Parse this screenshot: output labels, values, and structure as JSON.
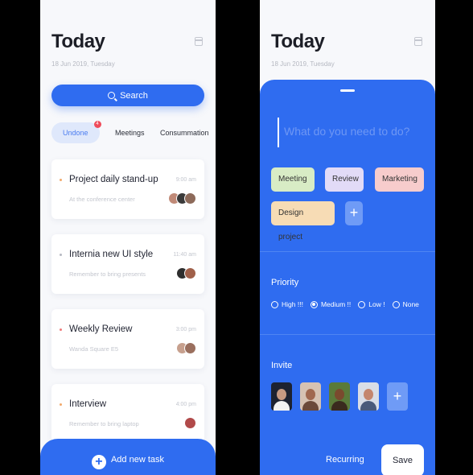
{
  "left_screen": {
    "title": "Today",
    "date": "18 Jun 2019, Tuesday",
    "search_label": "Search",
    "tabs": [
      {
        "label": "Undone",
        "badge": "4",
        "active": true
      },
      {
        "label": "Meetings",
        "active": false
      },
      {
        "label": "Consummation",
        "active": false
      }
    ],
    "tasks": [
      {
        "title": "Project daily stand-up",
        "time": "9:00 am",
        "subtitle": "At the conference center",
        "dot_color": "#f2a96b"
      },
      {
        "title": "Internia new UI style",
        "time": "11:40 am",
        "subtitle": "Remember to bring presents",
        "dot_color": "#b6b9c2"
      },
      {
        "title": "Weekly Review",
        "time": "3:00 pm",
        "subtitle": "Wanda Square E5",
        "dot_color": "#ef7b7b"
      },
      {
        "title": "Interview",
        "time": "4:00 pm",
        "subtitle": "Remember to bring laptop",
        "dot_color": "#f2a96b"
      }
    ],
    "add_task_label": "Add new task"
  },
  "right_screen": {
    "title": "Today",
    "date": "18 Jun 2019, Tuesday",
    "task_placeholder": "What do you need to do?",
    "tags": [
      {
        "label": "Meeting",
        "color": "#d8ecc5"
      },
      {
        "label": "Review",
        "color": "#e2dbf7"
      },
      {
        "label": "Marketing",
        "color": "#f7cccc"
      },
      {
        "label": "Design project",
        "color": "#f7dcb5"
      }
    ],
    "priority_label": "Priority",
    "priorities": [
      {
        "label": "High !!!",
        "selected": false
      },
      {
        "label": "Medium !!",
        "selected": true
      },
      {
        "label": "Low !",
        "selected": false
      },
      {
        "label": "None",
        "selected": false
      }
    ],
    "invite_label": "Invite",
    "recurring_label": "Recurring",
    "save_label": "Save"
  },
  "colors": {
    "accent": "#2f6cf0",
    "background": "#000000"
  }
}
